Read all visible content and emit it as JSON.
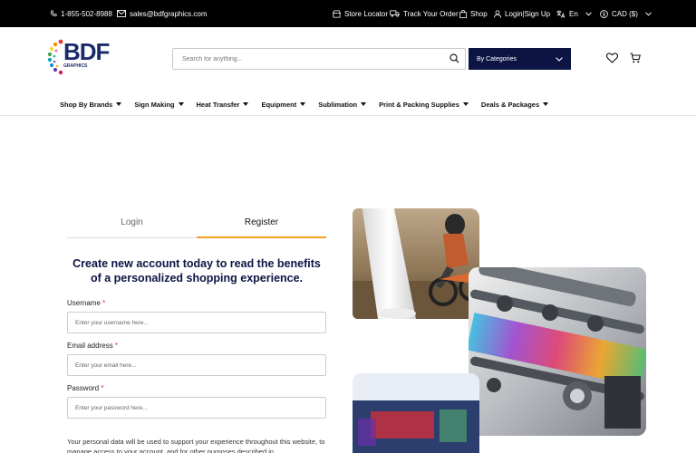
{
  "topbar": {
    "phone": "1-855-502-8988",
    "email": "sales@bdfgraphics.com",
    "store_locator": "Store Locator",
    "track_order": "Track Your Order",
    "shop": "Shop",
    "login_signup": "Login|Sign Up",
    "language": "En",
    "currency": "CAD ($)"
  },
  "logo": {
    "text": "BDF",
    "sub": "GRAPHICS"
  },
  "search": {
    "placeholder": "Search for anything..."
  },
  "categories": {
    "label": "By Categories"
  },
  "nav": [
    "Shop By Brands",
    "Sign Making",
    "Heat Transfer",
    "Equipment",
    "Sublimation",
    "Print & Packing Supplies",
    "Deals & Packages"
  ],
  "tabs": {
    "login": "Login",
    "register": "Register"
  },
  "headline": "Create new account today to read the benefits of a personalized shopping experience.",
  "form": {
    "username_label": "Username",
    "username_placeholder": "Enter your username here...",
    "email_label": "Email address",
    "email_placeholder": "Enter your email here...",
    "password_label": "Password",
    "password_placeholder": "Enter your password here...",
    "required_mark": "*"
  },
  "privacy_text": "Your personal data will be used to support your experience throughout this website, to manage access to your account, and for other purposes described in",
  "colors": {
    "navy": "#0c1444",
    "accent": "#f0a020",
    "required": "#dd3333"
  }
}
